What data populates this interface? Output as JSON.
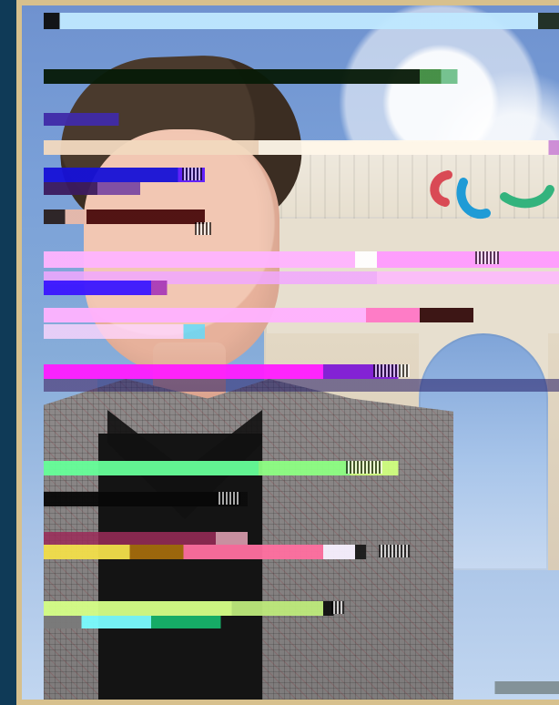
{
  "scene": {
    "type": "photo",
    "colors": {
      "background": "#0f3a57",
      "frame": "#d7c08d"
    },
    "icons": [
      "paralympic-logo-icon"
    ]
  }
}
